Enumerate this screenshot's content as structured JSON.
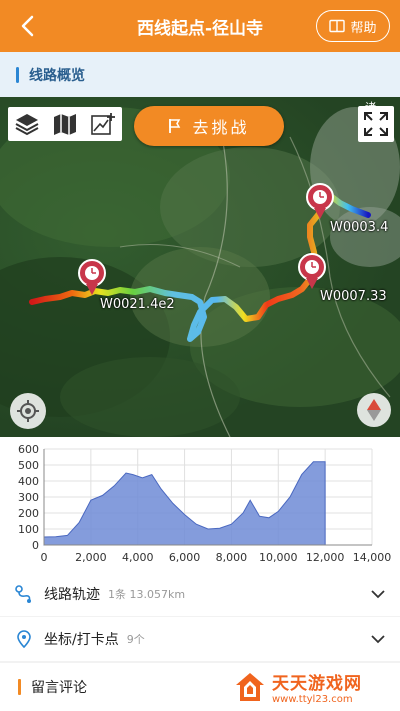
{
  "header": {
    "title": "西线起点-径山寺",
    "help_label": "帮助",
    "back_icon": "chevron-left-icon",
    "bg": "#f28a24"
  },
  "section": {
    "title": "线路概览"
  },
  "map": {
    "challenge_label": "去挑战",
    "corner_text": "诸",
    "waypoints": [
      "W0003.4",
      "W0007.33",
      "W0021.4e2"
    ],
    "tools": [
      "layers-icon",
      "map-icon",
      "draw-icon"
    ]
  },
  "chart_data": {
    "type": "area",
    "x": [
      0,
      500,
      1000,
      1500,
      2000,
      2500,
      3000,
      3500,
      3800,
      4200,
      4600,
      5000,
      5500,
      6000,
      6500,
      7000,
      7500,
      8000,
      8500,
      8800,
      9200,
      9600,
      10000,
      10500,
      11000,
      11500,
      12000
    ],
    "y": [
      50,
      52,
      60,
      140,
      280,
      310,
      370,
      450,
      440,
      420,
      440,
      350,
      260,
      190,
      130,
      100,
      105,
      130,
      200,
      280,
      180,
      170,
      210,
      300,
      440,
      520,
      520
    ],
    "xlim": [
      0,
      14000
    ],
    "ylim": [
      0,
      600
    ],
    "xticks": [
      "0",
      "2,000",
      "4,000",
      "6,000",
      "8,000",
      "10,000",
      "12,000",
      "14,000"
    ],
    "yticks": [
      "0",
      "100",
      "200",
      "300",
      "400",
      "500",
      "600"
    ],
    "color": "#6f8bd6",
    "grid": true
  },
  "rows": {
    "track": {
      "label": "线路轨迹",
      "sub": "1条 13.057km"
    },
    "coords": {
      "label": "坐标/打卡点",
      "sub": "9个"
    }
  },
  "comment": {
    "label": "留言评论"
  },
  "watermark": {
    "main": "天天游戏网",
    "url": "www.ttyl23.com"
  }
}
